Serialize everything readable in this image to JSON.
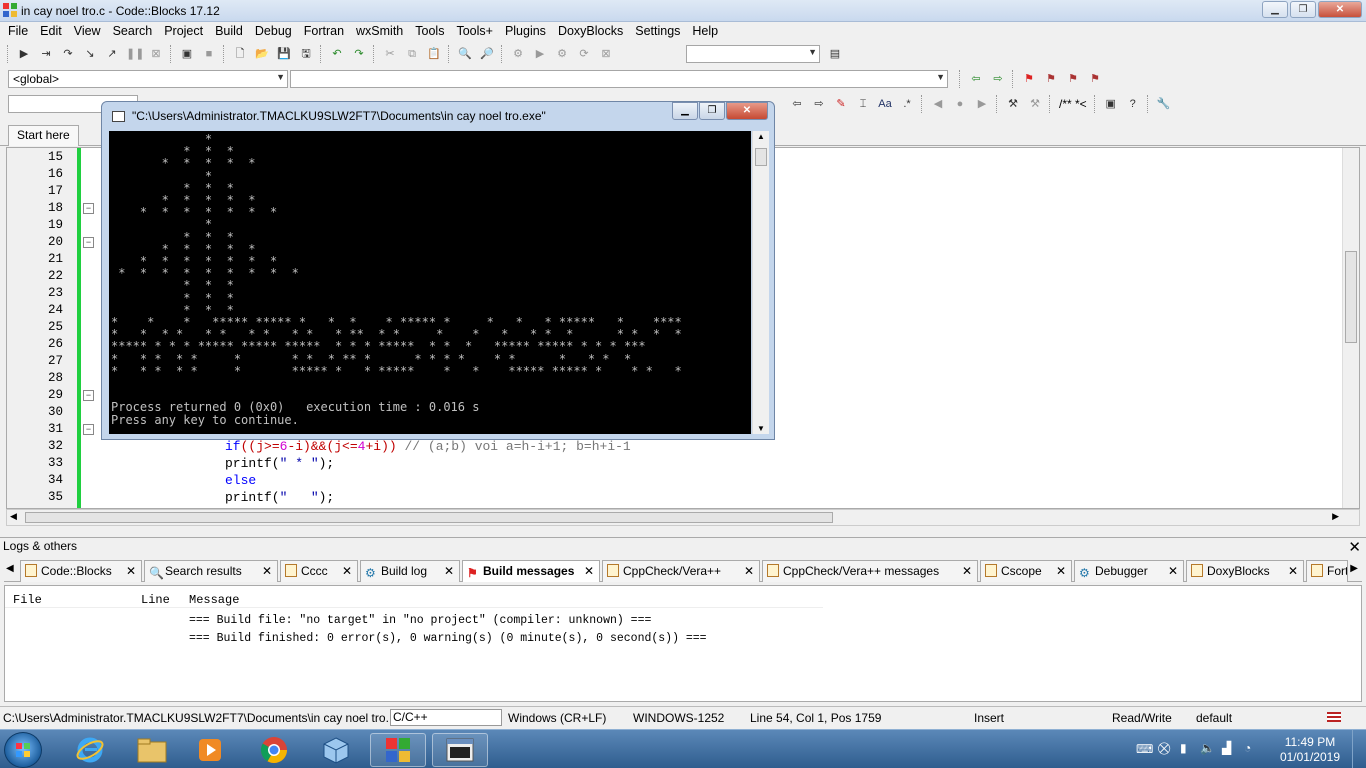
{
  "window": {
    "title": "in cay noel tro.c - Code::Blocks 17.12",
    "min": "▁",
    "max": "❐",
    "close": "✕"
  },
  "menu": [
    "File",
    "Edit",
    "View",
    "Search",
    "Project",
    "Build",
    "Debug",
    "Fortran",
    "wxSmith",
    "Tools",
    "Tools+",
    "Plugins",
    "DoxyBlocks",
    "Settings",
    "Help"
  ],
  "scope_combo": "<global>",
  "editor_tab": "Start here",
  "lines": [
    "15",
    "16",
    "17",
    "18",
    "19",
    "20",
    "21",
    "22",
    "23",
    "24",
    "25",
    "26",
    "27",
    "28",
    "29",
    "30",
    "31",
    "32",
    "33",
    "34",
    "35"
  ],
  "code": {
    "l32_if": "if",
    "l32_a": "((j>=",
    "l32_n1": "6",
    "l32_b": "-i)&&(j<=",
    "l32_n2": "4",
    "l32_c": "+i))",
    "l32_cmt": " // (a;b) voi a=h-i+1; b=h+i-1",
    "l33_fn": "printf(",
    "l33_str": "\" * \"",
    "l33_end": ");",
    "l34": "else",
    "l35_fn": "printf(",
    "l35_str": "\"   \"",
    "l35_end": ");"
  },
  "console": {
    "title": "\"C:\\Users\\Administrator.TMACLKU9SLW2FT7\\Documents\\in cay noel tro.exe\"",
    "output": "             *\n          *  *  *\n       *  *  *  *  *\n             *\n          *  *  *\n       *  *  *  *  *\n    *  *  *  *  *  *  *\n             *\n          *  *  *\n       *  *  *  *  *\n    *  *  *  *  *  *  *\n *  *  *  *  *  *  *  *  *\n          *  *  *\n          *  *  *\n          *  *  *\n*    *    *   ***** ***** *   *  *    * ***** *     *   *   * *****   *    ****\n*   *  * *   * *   * *   * *   * **  * *     *    *   *   * *  *      * *  *  *\n***** * * * ***** ***** *****  * * * *****  * *  *   ***** ***** * * * ***\n*   * *  * *     *       * *  * ** *      * * * *    * *      *   * *  *\n*   * *  * *     *       ***** *   * *****    *   *    ***** ***** *    * *   *\n\n\nProcess returned 0 (0x0)   execution time : 0.016 s\nPress any key to continue."
  },
  "logs": {
    "header": "Logs & others",
    "tabs": [
      "Code::Blocks",
      "Search results",
      "Cccc",
      "Build log",
      "Build messages",
      "CppCheck/Vera++",
      "CppCheck/Vera++ messages",
      "Cscope",
      "Debugger",
      "DoxyBlocks",
      "Fort"
    ],
    "columns": [
      "File",
      "Line",
      "Message"
    ],
    "rows": [
      "=== Build file: \"no target\" in \"no project\" (compiler: unknown) ===",
      "=== Build finished: 0 error(s), 0 warning(s) (0 minute(s), 0 second(s)) ==="
    ]
  },
  "status": {
    "path": "C:\\Users\\Administrator.TMACLKU9SLW2FT7\\Documents\\in cay noel tro.c",
    "lang": "C/C++",
    "eol": "Windows (CR+LF)",
    "encoding": "WINDOWS-1252",
    "position": "Line 54, Col 1, Pos 1759",
    "mode": "Insert",
    "access": "Read/Write",
    "theme": "default"
  },
  "clock": {
    "time": "11:49 PM",
    "date": "01/01/2019"
  },
  "toolbar_text": {
    "comment": "/** *<",
    "aa": "Aa"
  }
}
